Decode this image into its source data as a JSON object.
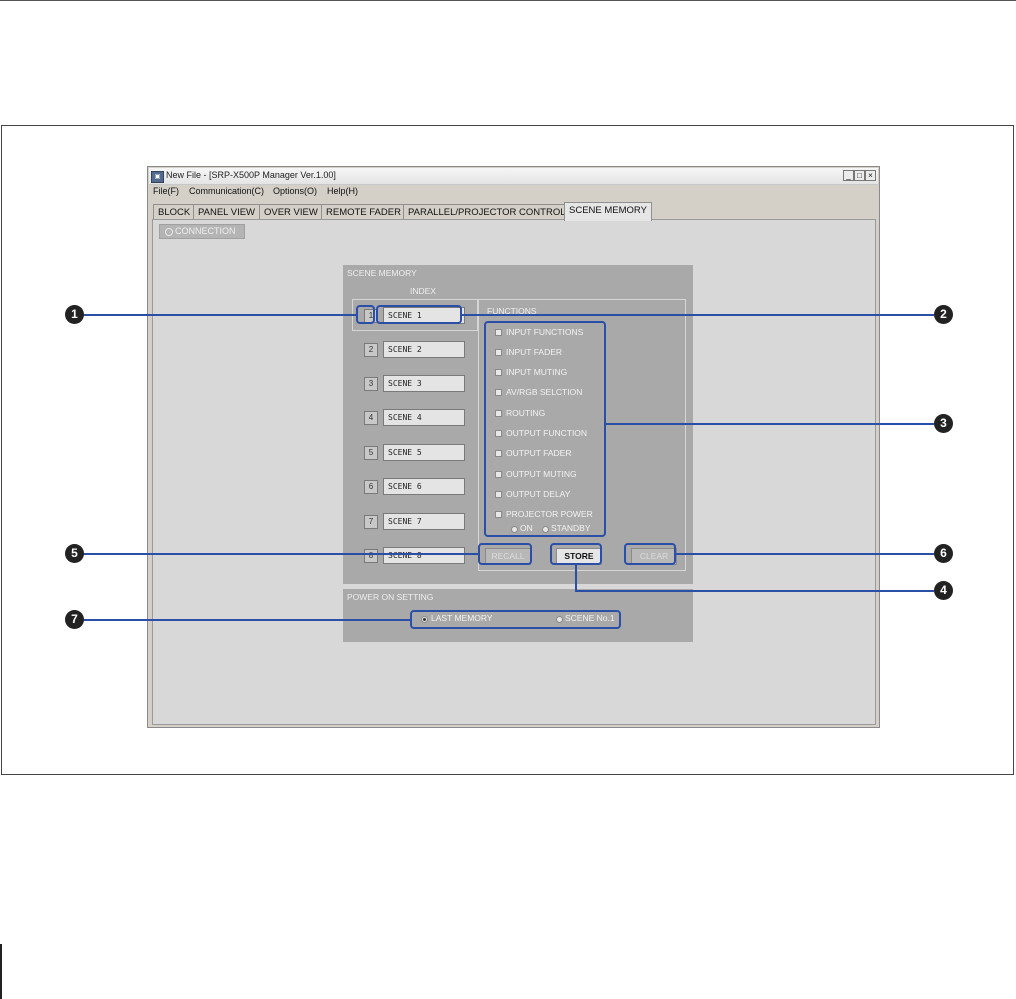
{
  "window": {
    "title": "New File - [SRP-X500P Manager Ver.1.00]",
    "menu": [
      "File(F)",
      "Communication(C)",
      "Options(O)",
      "Help(H)"
    ],
    "controls": [
      "_",
      "□",
      "×"
    ]
  },
  "tabs": [
    "BLOCK",
    "PANEL VIEW",
    "OVER VIEW",
    "REMOTE FADER",
    "PARALLEL/PROJECTOR CONTROL",
    "SCENE MEMORY"
  ],
  "active_tab": "SCENE MEMORY",
  "connection": {
    "label": "CONNECTION"
  },
  "scene_memory": {
    "title": "SCENE MEMORY",
    "index_label": "INDEX",
    "functions_label": "FUNCTIONS",
    "scenes": [
      {
        "num": "1",
        "name": "SCENE 1"
      },
      {
        "num": "2",
        "name": "SCENE 2"
      },
      {
        "num": "3",
        "name": "SCENE 3"
      },
      {
        "num": "4",
        "name": "SCENE 4"
      },
      {
        "num": "5",
        "name": "SCENE 5"
      },
      {
        "num": "6",
        "name": "SCENE 6"
      },
      {
        "num": "7",
        "name": "SCENE 7"
      },
      {
        "num": "8",
        "name": "SCENE 8"
      }
    ],
    "functions": [
      "INPUT FUNCTIONS",
      "INPUT FADER",
      "INPUT MUTING",
      "AV/RGB SELCTION",
      "ROUTING",
      "OUTPUT FUNCTION",
      "OUTPUT FADER",
      "OUTPUT MUTING",
      "OUTPUT DELAY",
      "PROJECTOR POWER"
    ],
    "projector_on": "ON",
    "projector_standby": "STANDBY",
    "recall": "RECALL",
    "store": "STORE",
    "clear": "CLEAR"
  },
  "power_on": {
    "title": "POWER ON SETTING",
    "last_memory": "LAST MEMORY",
    "scene_no1": "SCENE No.1",
    "selected": "LAST MEMORY"
  },
  "callouts": [
    "1",
    "2",
    "3",
    "4",
    "5",
    "6",
    "7"
  ],
  "colors": {
    "callout": "#2b4ea6",
    "marker": "#222222",
    "panel": "#a9a9a9"
  }
}
